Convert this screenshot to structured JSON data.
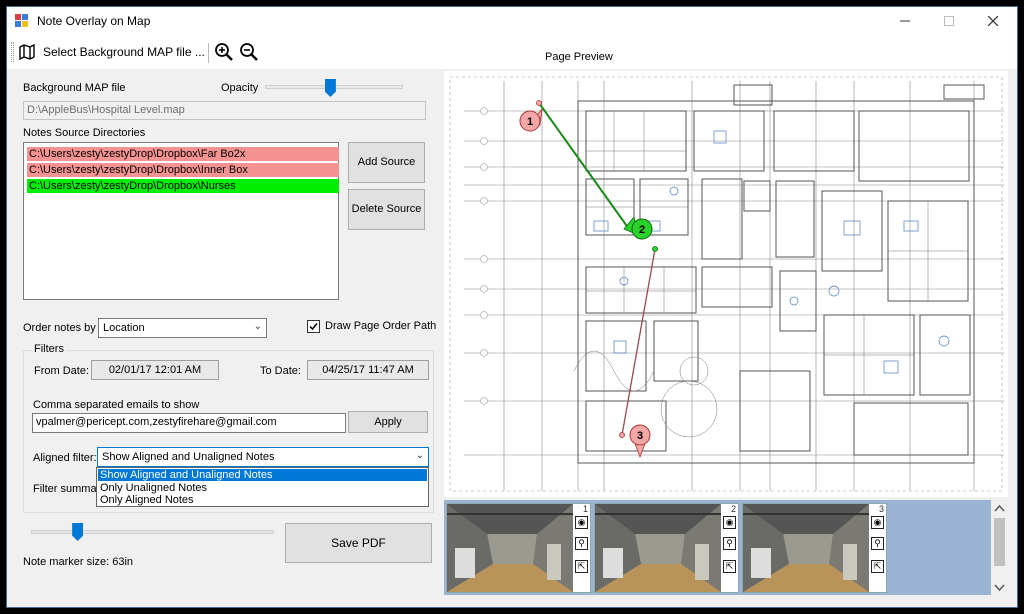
{
  "window": {
    "title": "Note Overlay on Map",
    "minimize_icon": "minimize-icon",
    "maximize_icon": "maximize-icon",
    "close_icon": "close-icon"
  },
  "toolbar": {
    "select_map_label": "Select Background MAP file ...",
    "map_icon": "map-icon",
    "zoom_in_icon": "zoom-in-icon",
    "zoom_out_icon": "zoom-out-icon"
  },
  "background_map": {
    "label": "Background MAP file",
    "path": "D:\\AppleBus\\Hospital Level.map",
    "opacity_label": "Opacity",
    "opacity_level": 0.47
  },
  "notes_sources": {
    "label": "Notes Source Directories",
    "items": [
      {
        "path": "C:\\Users\\zesty\\zestyDrop\\Dropbox\\Far Bo2x",
        "color": "#f59393"
      },
      {
        "path": "C:\\Users\\zesty\\zestyDrop\\Dropbox\\Inner Box",
        "color": "#f59393"
      },
      {
        "path": "C:\\Users\\zesty\\zestyDrop\\Dropbox\\Nurses",
        "color": "#00ee00"
      }
    ],
    "add_button": "Add Source",
    "delete_button": "Delete Source"
  },
  "order": {
    "label": "Order notes by",
    "value": "Location",
    "draw_path_label": "Draw Page Order Path",
    "draw_path_checked": true
  },
  "filters": {
    "group_label": "Filters",
    "from_label": "From Date:",
    "from_value": "02/01/17 12:01 AM",
    "to_label": "To Date:",
    "to_value": "04/25/17 11:47 AM",
    "emails_label": "Comma separated emails to show",
    "emails_value": "vpalmer@pericept.com,zestyfirehare@gmail.com",
    "apply_button": "Apply",
    "aligned_label": "Aligned filter:",
    "aligned_value": "Show Aligned and Unaligned Notes",
    "aligned_options": [
      "Show Aligned and Unaligned Notes",
      "Only Unaligned Notes",
      "Only Aligned Notes"
    ],
    "summary_label": "Filter summary"
  },
  "marker": {
    "size_label": "Note marker size: 63in",
    "size_level": 0.19
  },
  "save_pdf_button": "Save PDF",
  "preview": {
    "label": "Page Preview",
    "markers": [
      {
        "label": "1",
        "color": "#f4a7a7"
      },
      {
        "label": "2",
        "color": "#2ad12a"
      },
      {
        "label": "3",
        "color": "#f4a7a7"
      }
    ],
    "path_colors": [
      "#1a8a1a",
      "#9a4a4a"
    ]
  },
  "thumbnails": [
    {
      "number": "1",
      "icons": [
        "location-pin-icon",
        "zoom-icon",
        "export-icon"
      ]
    },
    {
      "number": "2",
      "icons": [
        "location-pin-icon",
        "zoom-icon",
        "export-icon"
      ]
    },
    {
      "number": "3",
      "icons": [
        "location-pin-icon",
        "zoom-icon",
        "export-icon"
      ]
    }
  ]
}
